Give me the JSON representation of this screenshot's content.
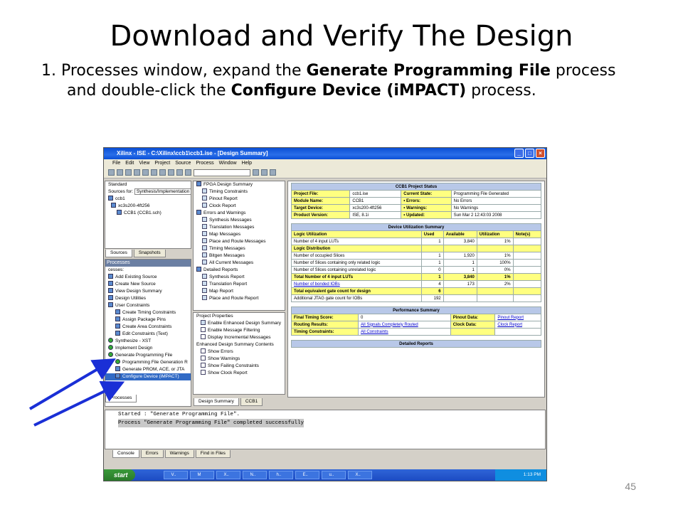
{
  "slide": {
    "title": "Download and Verify The Design",
    "body_prefix": "1. Processes window, expand the ",
    "body_bold1": "Generate Programming File",
    "body_mid": " process and double-click the ",
    "body_bold2": "Configure Device (iMPACT)",
    "body_suffix": " process.",
    "page_number": "45"
  },
  "window": {
    "title": "Xilinx - ISE - C:\\Xilinx\\ccb1\\ccb1.ise - [Design Summary]",
    "menu": [
      "File",
      "Edit",
      "View",
      "Project",
      "Source",
      "Process",
      "Window",
      "Help"
    ]
  },
  "sources": {
    "dropdown_label": "Sources for:",
    "dropdown_value": "Synthesis/Implementation",
    "mode": "Standard",
    "items": [
      "ccb1",
      "xc3s200-4ft256",
      "CCB1 (CCB1.sch)"
    ],
    "tabs": [
      "Sources",
      "Snapshots"
    ]
  },
  "processes": {
    "header": "Processes",
    "subheader": "cesses:",
    "items": [
      "Add Existing Source",
      "Create New Source",
      "View Design Summary",
      "Design Utilities",
      "User Constraints",
      "Create Timing Constraints",
      "Assign Package Pins",
      "Create Area Constraints",
      "Edit Constraints (Text)",
      "Synthesize - XST",
      "Implement Design",
      "Generate Programming File",
      "Programming File Generation R",
      "Generate PROM, ACE, or JTA",
      "Configure Device (iMPACT)"
    ],
    "tab": "Processes"
  },
  "summary_nav": {
    "items": [
      "FPGA Design Summary",
      "Timing Constraints",
      "Pinout Report",
      "Clock Report",
      "Errors and Warnings",
      "Synthesis Messages",
      "Translation Messages",
      "Map Messages",
      "Place and Route Messages",
      "Timing Messages",
      "Bitgen Messages",
      "All Current Messages",
      "Detailed Reports",
      "Synthesis Report",
      "Translation Report",
      "Map Report",
      "Place and Route Report"
    ],
    "props": [
      "Project Properties",
      "Enable Enhanced Design Summary",
      "Enable Message Filtering",
      "Display Incremental Messages",
      "Enhanced Design Summary Contents",
      "Show Errors",
      "Show Warnings",
      "Show Failing Constraints",
      "Show Clock Report"
    ],
    "tabs": [
      "Design Summary",
      "CCB1"
    ]
  },
  "project_status": {
    "title": "CCB1 Project Status",
    "rows": [
      [
        "Project File:",
        "ccb1.ise",
        "Current State:",
        "Programming File Generated"
      ],
      [
        "Module Name:",
        "CCB1",
        "• Errors:",
        "No Errors"
      ],
      [
        "Target Device:",
        "xc3s200-4ft256",
        "• Warnings:",
        "No Warnings"
      ],
      [
        "Product Version:",
        "ISE, 8.1i",
        "• Updated:",
        "Sun Mar 2 12:43:03 2008"
      ]
    ]
  },
  "utilization": {
    "title": "Device Utilization Summary",
    "headers": [
      "Logic Utilization",
      "Used",
      "Available",
      "Utilization",
      "Note(s)"
    ],
    "rows": [
      [
        "Number of 4 input LUTs",
        "1",
        "3,840",
        "1%",
        ""
      ],
      [
        "Logic Distribution",
        "",
        "",
        "",
        ""
      ],
      [
        "Number of occupied Slices",
        "1",
        "1,920",
        "1%",
        ""
      ],
      [
        "Number of Slices containing only related logic",
        "1",
        "1",
        "100%",
        ""
      ],
      [
        "Number of Slices containing unrelated logic",
        "0",
        "1",
        "0%",
        ""
      ],
      [
        "Total Number of 4 input LUTs",
        "1",
        "3,840",
        "1%",
        ""
      ],
      [
        "Number of bonded IOBs",
        "4",
        "173",
        "2%",
        ""
      ],
      [
        "Total equivalent gate count for design",
        "6",
        "",
        "",
        ""
      ],
      [
        "Additional JTAG gate count for IOBs",
        "192",
        "",
        "",
        ""
      ]
    ]
  },
  "performance": {
    "title": "Performance Summary",
    "rows": [
      [
        "Final Timing Score:",
        "0",
        "Pinout Data:",
        "Pinout Report"
      ],
      [
        "Routing Results:",
        "All Signals Completely Routed",
        "Clock Data:",
        "Clock Report"
      ],
      [
        "Timing Constraints:",
        "All Constraints",
        "",
        ""
      ]
    ],
    "detailed_title": "Detailed Reports"
  },
  "console": {
    "line1": "Started : \"Generate Programming File\".",
    "line2": "Process \"Generate Programming File\" completed successfully",
    "side_label": "Transcript",
    "tabs": [
      "Console",
      "Errors",
      "Warnings",
      "Find in Files"
    ]
  },
  "taskbar": {
    "start": "start",
    "tasks": [
      "V..",
      "M",
      "X..",
      "N..",
      "h..",
      "E..",
      "u..",
      "X.."
    ],
    "clock": "1:13 PM"
  }
}
